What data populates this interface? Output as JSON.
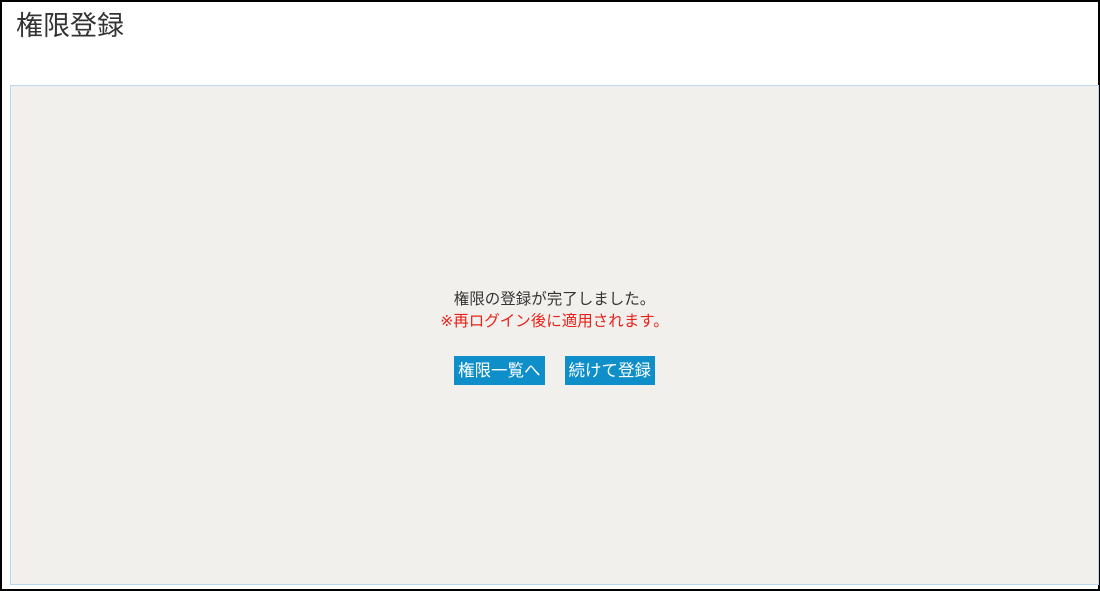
{
  "page": {
    "title": "権限登録"
  },
  "message": {
    "complete": "権限の登録が完了しました。",
    "notice": "※再ログイン後に適用されます。"
  },
  "buttons": {
    "to_list": "権限一覧へ",
    "continue_register": "続けて登録"
  },
  "colors": {
    "panel_background": "#f2f0ec",
    "button_background": "#0e8fca",
    "notice_text": "#e8221b"
  }
}
